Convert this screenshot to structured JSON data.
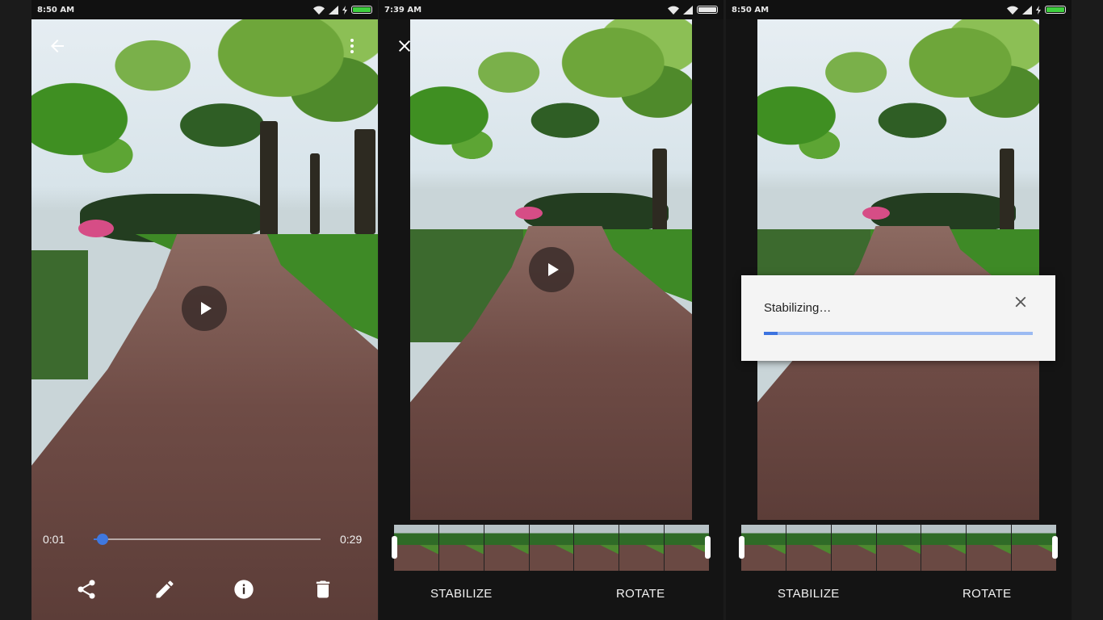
{
  "panel_viewer": {
    "status": {
      "time": "8:50 AM"
    },
    "icons": {
      "back": "back-arrow-icon",
      "overflow": "more-icon",
      "play": "play-icon"
    },
    "seek": {
      "current_time": "0:01",
      "duration": "0:29",
      "progress": 0.05
    },
    "actions": [
      {
        "name": "share",
        "icon": "share-icon"
      },
      {
        "name": "edit",
        "icon": "pencil-icon"
      },
      {
        "name": "info",
        "icon": "info-icon"
      },
      {
        "name": "delete",
        "icon": "trash-icon"
      }
    ]
  },
  "panel_editor": {
    "status": {
      "time": "7:39 AM"
    },
    "icons": {
      "close": "close-icon",
      "play": "play-icon"
    },
    "buttons": {
      "stabilize": "STABILIZE",
      "rotate": "ROTATE"
    }
  },
  "panel_stabilizing": {
    "status": {
      "time": "8:50 AM"
    },
    "buttons": {
      "stabilize": "STABILIZE",
      "rotate": "ROTATE"
    },
    "dialog": {
      "message": "Stabilizing…",
      "progress": 0.05,
      "close_icon": "close-icon"
    }
  },
  "colors": {
    "accent": "#3f78e0",
    "battery_charging": "#3ecf3e",
    "battery_full": "#e8e8e8",
    "dialog_background": "#f4f4f4",
    "lawn": "#3e8a26",
    "path": "#6f4c46"
  }
}
